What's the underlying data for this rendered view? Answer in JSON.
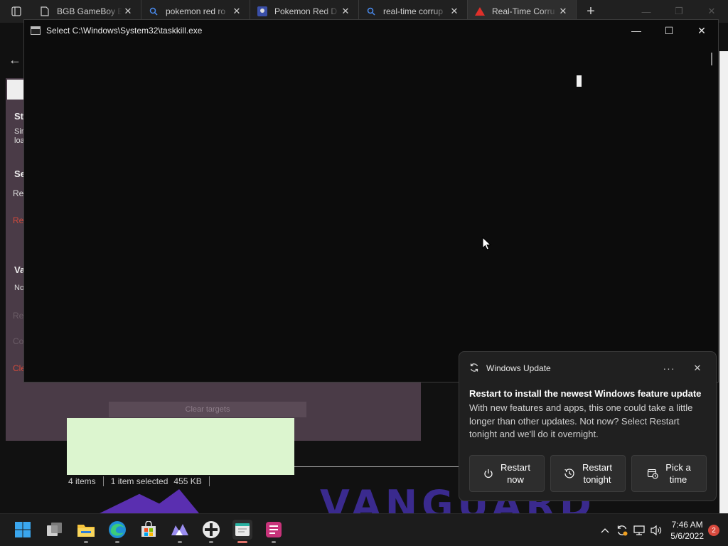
{
  "browser": {
    "tabs": [
      {
        "label": "BGB GameBoy E",
        "icon": "page-icon"
      },
      {
        "label": "pokemon red ro",
        "icon": "search-icon"
      },
      {
        "label": "Pokemon Red D",
        "icon": "site-icon"
      },
      {
        "label": "real-time corrup",
        "icon": "search-icon"
      },
      {
        "label": "Real-Time Corru",
        "icon": "warning-triangle-icon",
        "active": true
      }
    ]
  },
  "background_app": {
    "sidebar": [
      "St",
      "Sim",
      "loa",
      "Se",
      "Re",
      "Re",
      "Va",
      "No",
      "Re",
      "Co",
      "Cle"
    ],
    "clear_targets_label": "Clear targets",
    "explorer_status": {
      "items": "4 items",
      "selected": "1 item selected",
      "size": "455 KB"
    },
    "banner_text": "VANGUARD"
  },
  "console": {
    "title": "Select C:\\Windows\\System32\\taskkill.exe"
  },
  "notification": {
    "app_name": "Windows Update",
    "title": "Restart to install the newest Windows feature update",
    "body": "With new features and apps, this one could take a little longer than other updates. Not now? Select Restart tonight and we'll do it overnight.",
    "actions": [
      {
        "line1": "Restart",
        "line2": "now",
        "icon": "power-icon"
      },
      {
        "line1": "Restart",
        "line2": "tonight",
        "icon": "clock-icon"
      },
      {
        "line1": "Pick a",
        "line2": "time",
        "icon": "calendar-icon"
      }
    ]
  },
  "taskbar": {
    "apps": [
      "start",
      "task-view",
      "file-explorer",
      "edge",
      "store",
      "vtuber-app",
      "gamepad-app",
      "notepad-app",
      "notes-app"
    ],
    "clock_time": "7:46 AM",
    "clock_date": "5/6/2022",
    "notification_count": "2"
  },
  "colors": {
    "accent_red": "#d84a3e",
    "notification_bg": "#202020",
    "console_bg": "#0c0c0c"
  }
}
